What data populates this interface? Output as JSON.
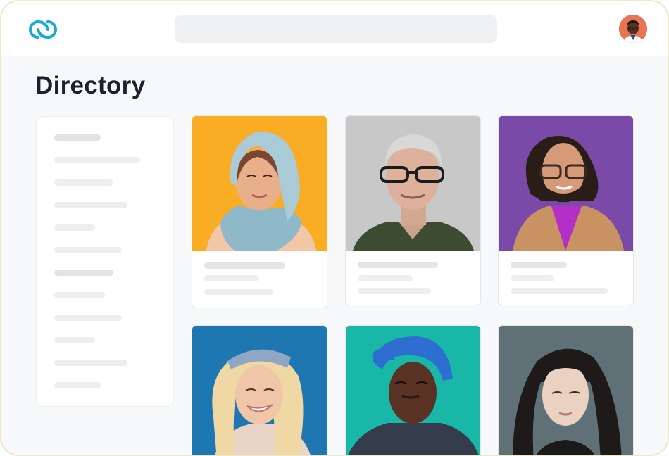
{
  "header": {
    "logo_icon": "linked-rings-logo-icon",
    "brand_color": "#1aa9d6",
    "search_placeholder": "",
    "avatar_icon": "user-avatar"
  },
  "page": {
    "title": "Directory"
  },
  "sidebar": {
    "items": 12
  },
  "directory": {
    "people": [
      {
        "name": "person-1",
        "bg": "#f9ad24"
      },
      {
        "name": "person-2",
        "bg": "#c7c7c7"
      },
      {
        "name": "person-3",
        "bg": "#7a4aa8"
      },
      {
        "name": "person-4",
        "bg": "#1f77b2"
      },
      {
        "name": "person-5",
        "bg": "#19b7a8"
      },
      {
        "name": "person-6",
        "bg": "#5f7176"
      }
    ]
  }
}
